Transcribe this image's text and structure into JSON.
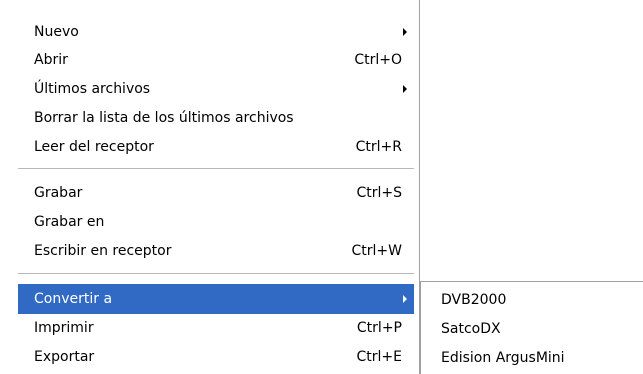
{
  "menu": {
    "items": [
      {
        "label": "Nuevo",
        "shortcut": "",
        "submenu": true
      },
      {
        "label": "Abrir",
        "shortcut": "Ctrl+O",
        "submenu": false
      },
      {
        "label": "Últimos archivos",
        "shortcut": "",
        "submenu": true
      },
      {
        "label": "Borrar la lista de los últimos archivos",
        "shortcut": "",
        "submenu": false
      },
      {
        "label": "Leer del receptor",
        "shortcut": "Ctrl+R",
        "submenu": false
      },
      {
        "label": "Grabar",
        "shortcut": "Ctrl+S",
        "submenu": false
      },
      {
        "label": "Grabar en",
        "shortcut": "",
        "submenu": false
      },
      {
        "label": "Escribir en receptor",
        "shortcut": "Ctrl+W",
        "submenu": false
      },
      {
        "label": "Convertir a",
        "shortcut": "",
        "submenu": true,
        "selected": true
      },
      {
        "label": "Imprimir",
        "shortcut": "Ctrl+P",
        "submenu": false
      },
      {
        "label": "Exportar",
        "shortcut": "Ctrl+E",
        "submenu": false
      }
    ]
  },
  "submenu": {
    "items": [
      {
        "label": "DVB2000"
      },
      {
        "label": "SatcoDX"
      },
      {
        "label": "Edision ArgusMini"
      }
    ]
  },
  "colors": {
    "selection": "#316ac5",
    "border": "#a0a0a0",
    "background": "#ffffff"
  }
}
